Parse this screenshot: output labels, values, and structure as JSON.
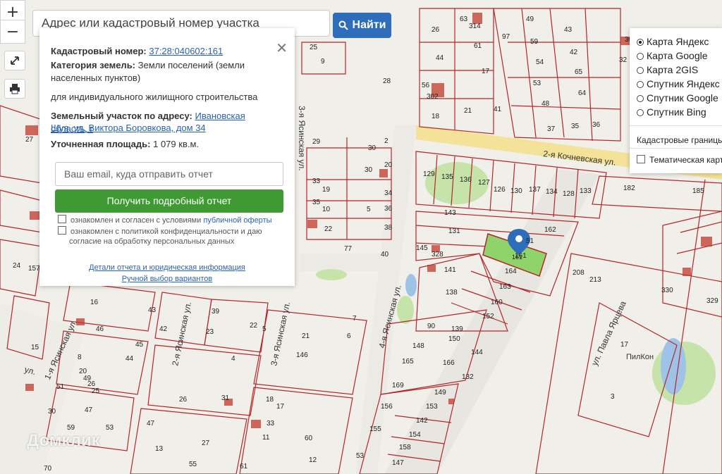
{
  "search": {
    "placeholder": "Адрес или кадастровый номер участка",
    "button_label": "Найти"
  },
  "map_controls": {
    "zoom_in": "+",
    "zoom_out": "−"
  },
  "info_panel": {
    "cadastral_label": "Кадастровый номер:",
    "cadastral_number": "37:28:040602:161",
    "category_label": "Категория земель:",
    "category_value_1": "Земли поселений (земли",
    "category_value_2": "населенных пунктов)",
    "category_value_3": "для индивидуального жилищного строительства",
    "address_label": "Земельный участок по адресу:",
    "address_value_1": "Ивановская область, г",
    "address_value_2": "Шуя, ул. Виктора Боровкова, дом 34",
    "area_label": "Уточненная площадь:",
    "area_value": "1 079 кв.м.",
    "email_placeholder": "Ваш email, куда отправить отчет",
    "report_button": "Получить подробный отчет",
    "consent1_a": "ознакомлен и согласен с условиями",
    "consent1_link": "публичной оферты",
    "consent2_a": "ознакомлен с политикой конфиденциальности и даю",
    "consent2_b": "согласие на обработку персональных данных",
    "details_link": "Детали отчета и юридическая информация",
    "manual_link": "Ручной выбор вариантов"
  },
  "layers": {
    "options": [
      "Карта Яндекс",
      "Карта Google",
      "Карта 2GIS",
      "Спутник Яндекс",
      "Спутник Google",
      "Спутник Bing"
    ],
    "selected": "Карта Яндекс",
    "cadastral_borders": "Кадастровые границы",
    "thematic_map": "Тематическая карта"
  },
  "map_labels": {
    "streets": [
      "2-я Кочневская ул.",
      "3-я Ясинская ул.",
      "2-я Ясинская ул.",
      "3-я Ясинская ул.",
      "4-я Ясинская ул.",
      "1-я Ясинская ул.",
      "ул. Павла Ярцева",
      "ул."
    ],
    "poi": "ПилКон",
    "plots": [
      "63",
      "314",
      "97",
      "49",
      "26",
      "61",
      "43",
      "59",
      "42",
      "44",
      "17",
      "54",
      "65",
      "56",
      "302",
      "53",
      "64",
      "18",
      "21",
      "41",
      "48",
      "37",
      "35",
      "36",
      "32",
      "30",
      "30",
      "2",
      "30",
      "20",
      "129",
      "135",
      "136",
      "127",
      "126",
      "130",
      "137",
      "134",
      "128",
      "133",
      "182",
      "185",
      "19",
      "34",
      "10",
      "5",
      "36",
      "143",
      "162",
      "22",
      "38",
      "131",
      "51",
      "145",
      "328",
      "161",
      "164",
      "163",
      "141",
      "138",
      "160",
      "152",
      "208",
      "213",
      "77",
      "40",
      "9",
      "28",
      "25",
      "27",
      "29",
      "33",
      "35",
      "43",
      "42",
      "46",
      "45",
      "44",
      "8",
      "20",
      "26",
      "25",
      "47",
      "49",
      "24",
      "157",
      "15",
      "16",
      "39",
      "23",
      "22",
      "5",
      "4",
      "7",
      "6",
      "21",
      "146",
      "90",
      "139",
      "150",
      "144",
      "148",
      "165",
      "166",
      "132",
      "169",
      "149",
      "156",
      "153",
      "142",
      "155",
      "154",
      "158",
      "147",
      "53",
      "18",
      "17",
      "33",
      "11",
      "60",
      "12",
      "27",
      "31",
      "26",
      "13",
      "55",
      "59",
      "53",
      "47",
      "30",
      "70",
      "61",
      "51",
      "329",
      "330",
      "17",
      "3"
    ],
    "highlighted_plot": "161"
  },
  "watermark": "Домклик",
  "colors": {
    "parcel_border": "#b3262b",
    "highlight": "#8fd46a",
    "button_blue": "#2e6dba",
    "button_green": "#3f9a33",
    "road": "#f4df8b",
    "green_area": "#c6e3a9",
    "water": "#9fc3e6",
    "building": "#c0392b"
  }
}
